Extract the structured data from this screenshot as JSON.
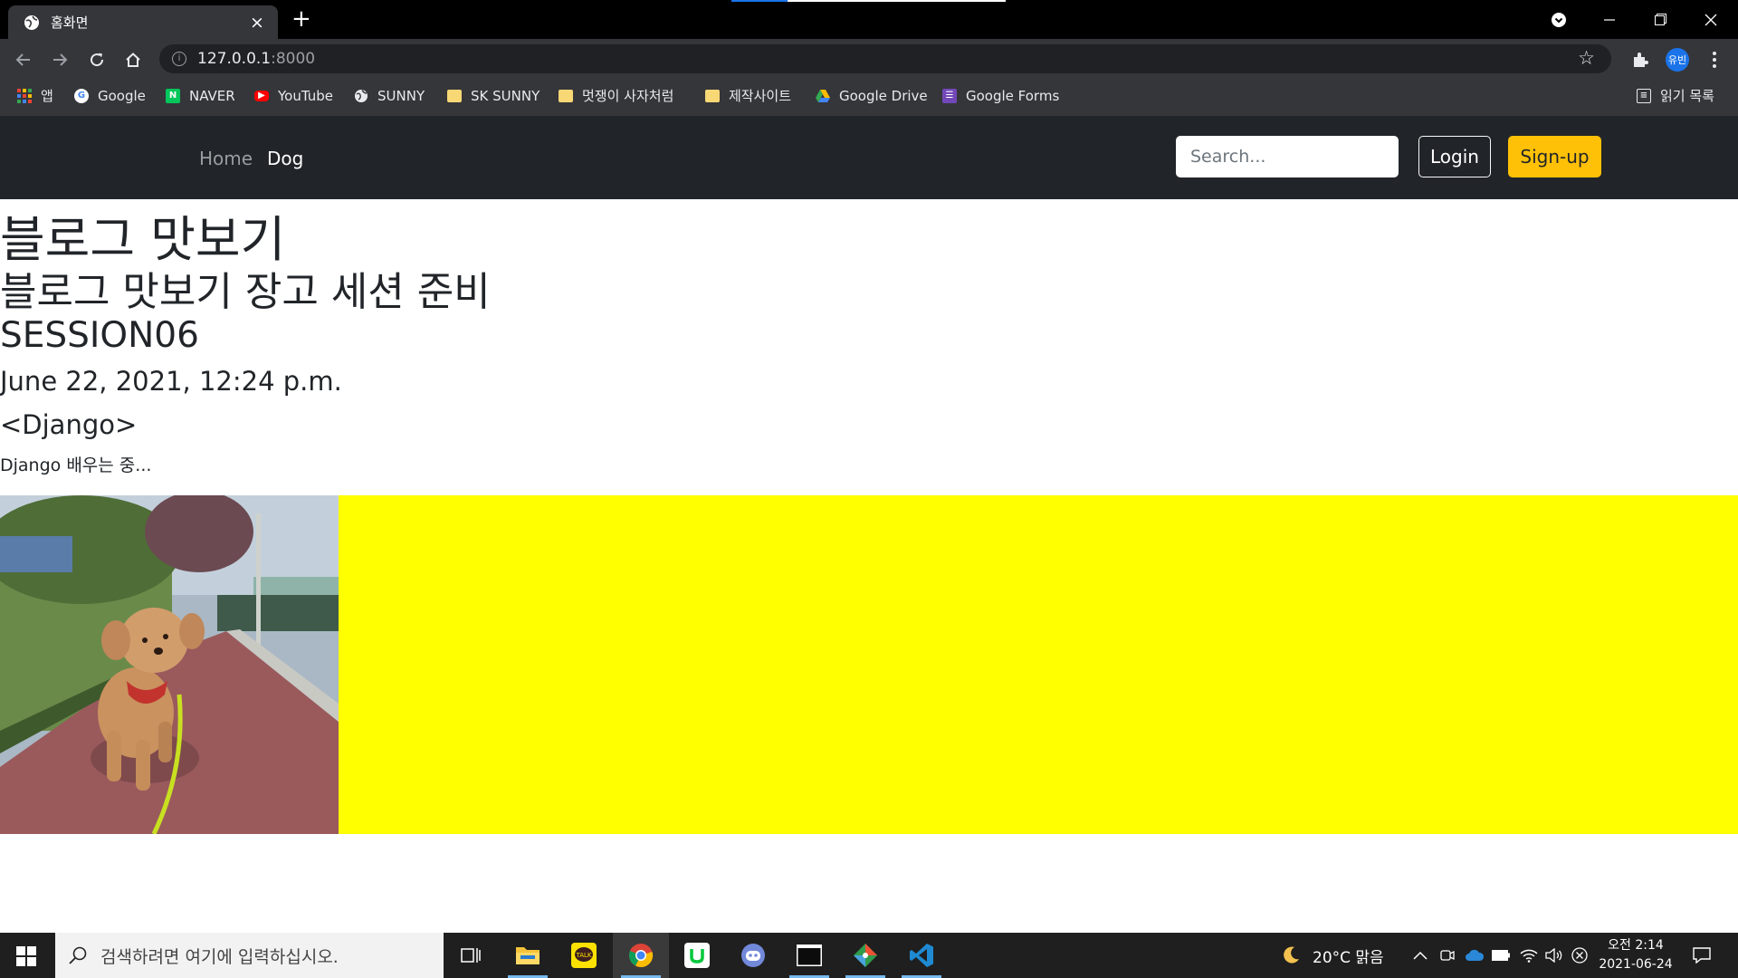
{
  "browser": {
    "tab_title": "홈화면",
    "tab_close": "×",
    "new_tab": "+",
    "url_host": "127.0.0.1",
    "url_port": ":8000",
    "profile": "유빈",
    "bookmarks": [
      {
        "label": "앱",
        "icon": "apps-grid-icon"
      },
      {
        "label": "Google",
        "icon": "google-icon"
      },
      {
        "label": "NAVER",
        "icon": "naver-icon"
      },
      {
        "label": "YouTube",
        "icon": "youtube-icon"
      },
      {
        "label": "SUNNY",
        "icon": "globe-icon"
      },
      {
        "label": "SK SUNNY",
        "icon": "folder-icon"
      },
      {
        "label": "멋쟁이 사자처럼",
        "icon": "folder-icon"
      },
      {
        "label": "제작사이트",
        "icon": "folder-icon"
      },
      {
        "label": "Google Drive",
        "icon": "google-drive-icon"
      },
      {
        "label": "Google Forms",
        "icon": "google-forms-icon"
      }
    ],
    "reading_list": "읽기 목록"
  },
  "site_nav": {
    "home": "Home",
    "dog": "Dog",
    "search_placeholder": "Search...",
    "login": "Login",
    "signup": "Sign-up"
  },
  "post": {
    "h1": "블로그 맛보기",
    "h2": "블로그 맛보기 장고 세션 준비",
    "session": "SESSION06",
    "date": "June 22, 2021, 12:24 p.m.",
    "tag": "<Django>",
    "body": "Django 배우는 중..."
  },
  "taskbar": {
    "search_placeholder": "검색하려면 여기에 입력하십시오.",
    "weather": "20°C  맑음",
    "time": "오전 2:14",
    "date": "2021-06-24"
  },
  "colors": {
    "navbar": "#212529",
    "signup": "#ffc107",
    "banner": "#ffff00"
  }
}
